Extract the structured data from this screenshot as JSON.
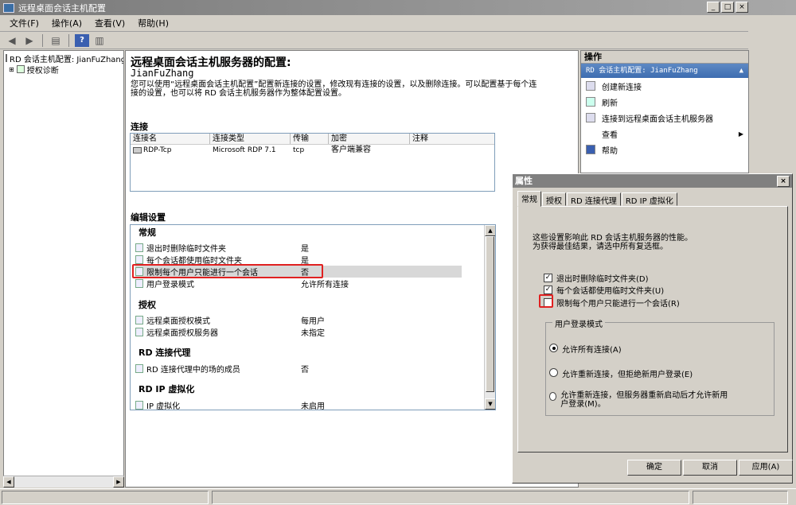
{
  "window": {
    "title": "远程桌面会话主机配置"
  },
  "menu": [
    "文件(F)",
    "操作(A)",
    "查看(V)",
    "帮助(H)"
  ],
  "tree": {
    "root": "RD 会话主机配置: JianFuZhang",
    "child": "授权诊断"
  },
  "main": {
    "title": "远程桌面会话主机服务器的配置:",
    "server": "JianFuZhang",
    "description": "您可以使用“远程桌面会话主机配置”配置新连接的设置，修改现有连接的设置，以及删除连接。可以配置基于每个连接的设置，也可以将 RD 会话主机服务器作为整体配置设置。",
    "connections_header": "连接",
    "columns": [
      "连接名",
      "连接类型",
      "传输",
      "加密",
      "注释"
    ],
    "rows": [
      {
        "name": "RDP-Tcp",
        "type": "Microsoft RDP 7.1",
        "transport": "tcp",
        "encryption": "客户端兼容",
        "comment": ""
      }
    ],
    "edit_header": "编辑设置",
    "groups": {
      "general": "常规",
      "licensing": "授权",
      "broker": "RD 连接代理",
      "ipv": "RD IP 虚拟化"
    },
    "settings": [
      {
        "label": "退出时删除临时文件夹",
        "value": "是"
      },
      {
        "label": "每个会话都使用临时文件夹",
        "value": "是"
      },
      {
        "label": "限制每个用户只能进行一个会话",
        "value": "否"
      },
      {
        "label": "用户登录模式",
        "value": "允许所有连接"
      },
      {
        "label": "远程桌面授权模式",
        "value": "每用户"
      },
      {
        "label": "远程桌面授权服务器",
        "value": "未指定"
      },
      {
        "label": "RD 连接代理中的场的成员",
        "value": "否"
      },
      {
        "label": "IP 虚拟化",
        "value": "未启用"
      }
    ]
  },
  "actions": {
    "header": "操作",
    "subheader": "RD 会话主机配置: JianFuZhang",
    "items": [
      "创建新连接",
      "刷新",
      "连接到远程桌面会话主机服务器",
      "查看",
      "帮助"
    ]
  },
  "dialog": {
    "title": "属性",
    "tabs": [
      "常规",
      "授权",
      "RD 连接代理",
      "RD IP 虚拟化"
    ],
    "desc1": "这些设置影响此 RD 会话主机服务器的性能。",
    "desc2": "为获得最佳结果，请选中所有复选框。",
    "checkboxes": [
      {
        "label": "退出时删除临时文件夹(D)",
        "checked": true
      },
      {
        "label": "每个会话都使用临时文件夹(U)",
        "checked": true
      },
      {
        "label": "限制每个用户只能进行一个会话(R)",
        "checked": false
      }
    ],
    "group_label": "用户登录模式",
    "radios": [
      {
        "label": "允许所有连接(A)",
        "selected": true
      },
      {
        "label": "允许重新连接，但拒绝新用户登录(E)",
        "selected": false
      },
      {
        "label": "允许重新连接，但服务器重新启动后才允许新用户登录(M)。",
        "selected": false
      }
    ],
    "buttons": {
      "ok": "确定",
      "cancel": "取消",
      "apply": "应用(A)"
    }
  }
}
